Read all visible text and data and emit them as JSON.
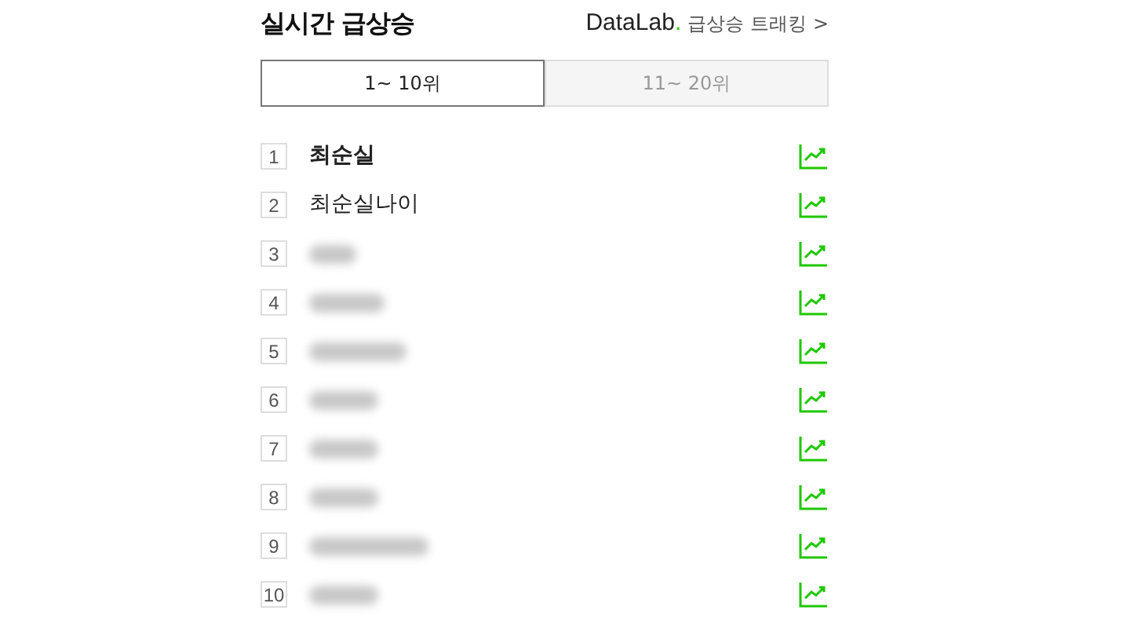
{
  "header": {
    "title": "실시간 급상승",
    "brand": "DataLab",
    "brand_dot": ".",
    "link": "급상승 트래킹",
    "link_arrow": ">"
  },
  "tabs": [
    {
      "label": "1~ 10위",
      "selected": true
    },
    {
      "label": "11~ 20위",
      "selected": false
    }
  ],
  "rows": [
    {
      "rank": "1",
      "kind": "keyword",
      "keyword": "최순실",
      "emphasized": true
    },
    {
      "rank": "2",
      "kind": "keyword",
      "keyword": "최순실나이",
      "emphasized": false
    },
    {
      "rank": "3",
      "kind": "blurred"
    },
    {
      "rank": "4",
      "kind": "blurred"
    },
    {
      "rank": "5",
      "kind": "blurred"
    },
    {
      "rank": "6",
      "kind": "blurred"
    },
    {
      "rank": "7",
      "kind": "blurred"
    },
    {
      "rank": "8",
      "kind": "blurred"
    },
    {
      "rank": "9",
      "kind": "blurred"
    },
    {
      "rank": "10",
      "kind": "blurred"
    }
  ]
}
